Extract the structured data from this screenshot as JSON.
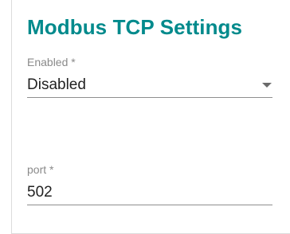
{
  "section": {
    "title": "Modbus TCP Settings"
  },
  "enabled": {
    "label": "Enabled *",
    "value": "Disabled"
  },
  "port": {
    "label": "port *",
    "value": "502"
  },
  "icons": {
    "dropdown": "chevron-down-icon"
  },
  "colors": {
    "title": "#008a8c",
    "label": "#8a8a8a",
    "value": "#222222",
    "underline": "#8f8f8f"
  }
}
